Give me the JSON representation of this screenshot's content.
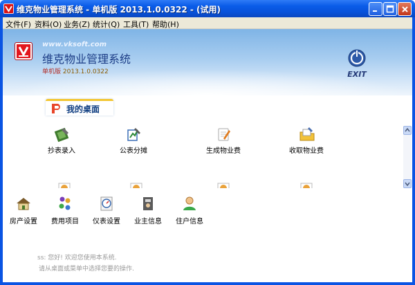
{
  "window": {
    "title": "维克物业管理系统 - 单机版 2013.1.0.0322 - (试用)",
    "controls": [
      "minimize",
      "maximize",
      "close"
    ]
  },
  "menu": [
    {
      "label": "文件(F)"
    },
    {
      "label": "资料(O)"
    },
    {
      "label": "业务(Z)"
    },
    {
      "label": "统计(Q)"
    },
    {
      "label": "工具(T)"
    },
    {
      "label": "帮助(H)"
    }
  ],
  "header": {
    "url": "www.vksoft.com",
    "app_name": "维克物业管理系统",
    "edition": "单机版",
    "version": "2013.1.0.0322",
    "exit_label": "EXIT"
  },
  "tab": {
    "label": "我的桌面"
  },
  "tasks": [
    {
      "label": "抄表录入",
      "icon": "meter-entry-icon"
    },
    {
      "label": "公表分摊",
      "icon": "shared-meter-icon"
    },
    {
      "label": "生成物业费",
      "icon": "generate-fee-icon"
    },
    {
      "label": "收取物业费",
      "icon": "collect-fee-icon"
    }
  ],
  "tools": [
    {
      "label": "房产设置",
      "icon": "house-icon"
    },
    {
      "label": "费用项目",
      "icon": "fee-items-icon"
    },
    {
      "label": "仪表设置",
      "icon": "meter-settings-icon"
    },
    {
      "label": "业主信息",
      "icon": "owner-info-icon"
    },
    {
      "label": "住户信息",
      "icon": "resident-info-icon"
    }
  ],
  "status": {
    "greeting_prefix": "ss:",
    "greeting": "您好! 欢迎您使用本系统.",
    "hint": "请从桌面或菜单中选择您要的操作."
  },
  "colors": {
    "titlebar": "#0a5ce8",
    "header_top": "#7fb4e6",
    "tab_accent": "#f3c62f",
    "logo": "#e3161d"
  }
}
